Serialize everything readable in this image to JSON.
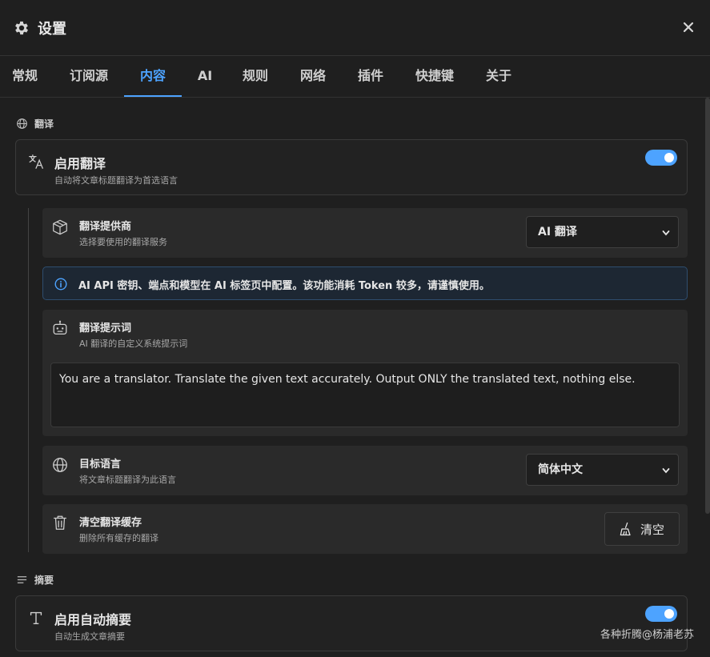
{
  "header": {
    "title": "设置",
    "icon": "gear-icon"
  },
  "tabs": [
    {
      "label": "常规",
      "active": false
    },
    {
      "label": "订阅源",
      "active": false
    },
    {
      "label": "内容",
      "active": true
    },
    {
      "label": "AI",
      "active": false
    },
    {
      "label": "规则",
      "active": false
    },
    {
      "label": "网络",
      "active": false
    },
    {
      "label": "插件",
      "active": false
    },
    {
      "label": "快捷键",
      "active": false
    },
    {
      "label": "关于",
      "active": false
    }
  ],
  "translation": {
    "section_label": "翻译",
    "enable": {
      "title": "启用翻译",
      "desc": "自动将文章标题翻译为首选语言",
      "on": true
    },
    "provider": {
      "title": "翻译提供商",
      "desc": "选择要使用的翻译服务",
      "value": "AI 翻译"
    },
    "info": "AI API 密钥、端点和模型在 AI 标签页中配置。该功能消耗 Token 较多，请谨慎使用。",
    "prompt": {
      "title": "翻译提示词",
      "desc": "AI 翻译的自定义系统提示词",
      "value": "You are a translator. Translate the given text accurately. Output ONLY the translated text, nothing else."
    },
    "target": {
      "title": "目标语言",
      "desc": "将文章标题翻译为此语言",
      "value": "简体中文"
    },
    "clear": {
      "title": "清空翻译缓存",
      "desc": "删除所有缓存的翻译",
      "button": "清空"
    }
  },
  "summary": {
    "section_label": "摘要",
    "enable": {
      "title": "启用自动摘要",
      "desc": "自动生成文章摘要",
      "on": true
    }
  },
  "watermark": "各种折腾@杨浦老苏",
  "colors": {
    "accent": "#4da3ff",
    "annotation_arrow": "#e53935",
    "background": "#1f1f1f"
  }
}
